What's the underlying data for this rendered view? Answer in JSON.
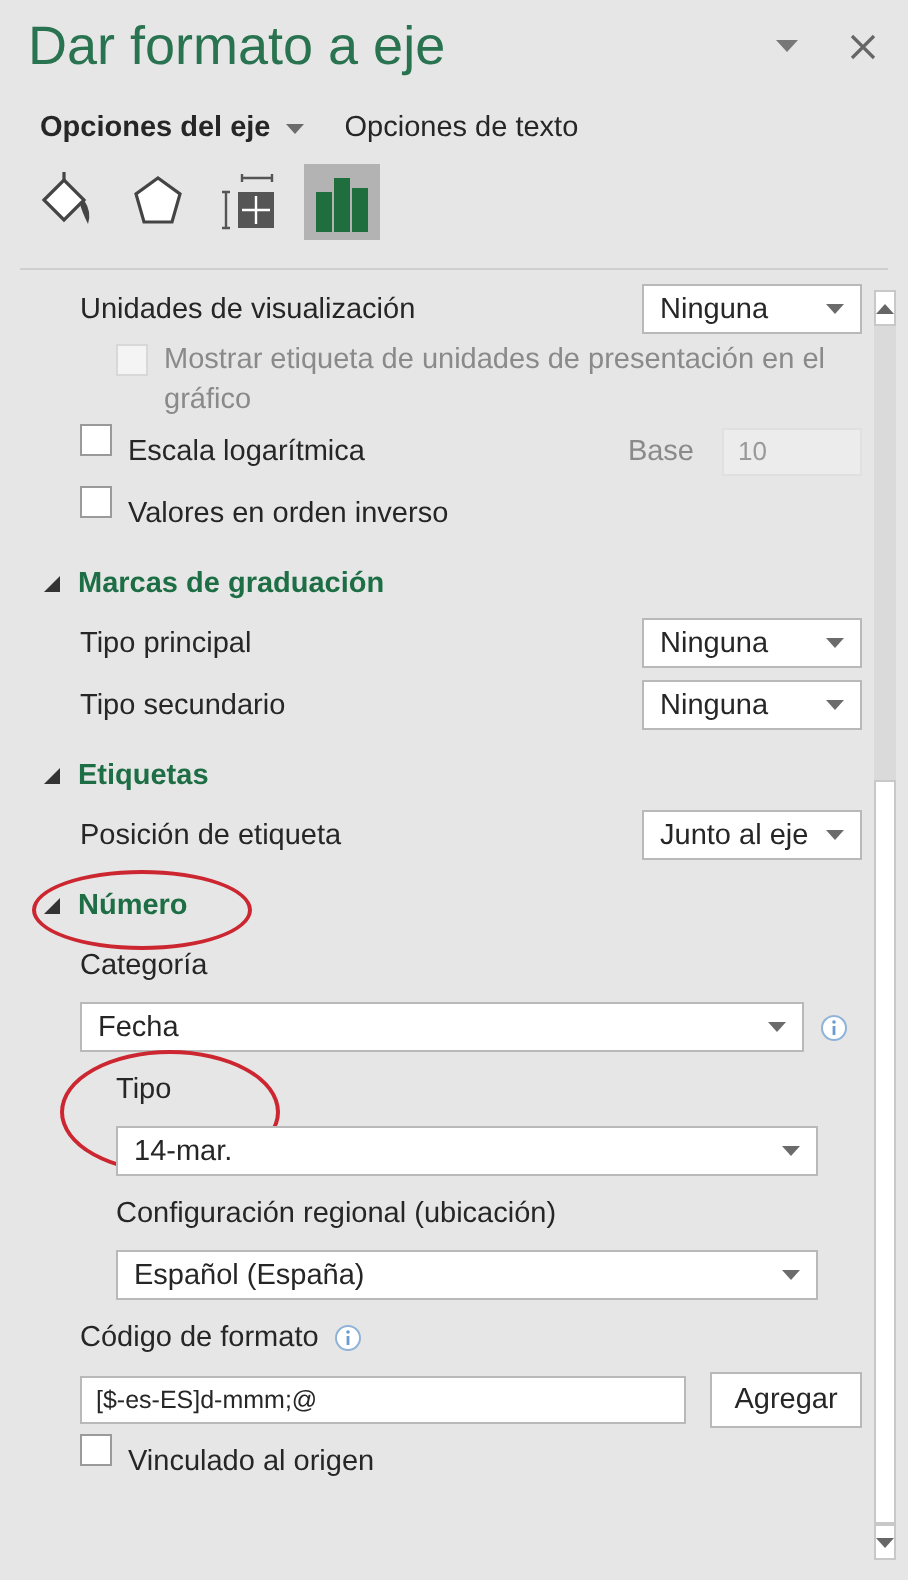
{
  "panel": {
    "title": "Dar formato a eje"
  },
  "tabs": [
    {
      "label": "Opciones del eje",
      "selected": true,
      "has_menu": true
    },
    {
      "label": "Opciones de texto",
      "selected": false,
      "has_menu": false
    }
  ],
  "icon_tabs": [
    {
      "kind": "fill",
      "selected": false
    },
    {
      "kind": "effects",
      "selected": false
    },
    {
      "kind": "size",
      "selected": false
    },
    {
      "kind": "axis",
      "selected": true
    }
  ],
  "top_items": [
    {
      "kind": "select",
      "label": "Unidades de visualización",
      "value": "Ninguna"
    },
    {
      "kind": "checkbox",
      "label": "Mostrar etiqueta de unidades de presentación en el gráfico",
      "checked": false,
      "disabled": true,
      "indent": true
    },
    {
      "kind": "checkbox_base",
      "label": "Escala logarítmica",
      "checked": false,
      "disabled": false,
      "base_label": "Base",
      "base_value": "10"
    },
    {
      "kind": "checkbox",
      "label": "Valores en orden inverso",
      "checked": false,
      "disabled": false,
      "indent": false
    }
  ],
  "sections": [
    {
      "title": "Marcas de graduación",
      "expanded": true,
      "circled": false,
      "items": [
        {
          "kind": "select",
          "label": "Tipo principal",
          "value": "Ninguna"
        },
        {
          "kind": "select",
          "label": "Tipo secundario",
          "value": "Ninguna"
        }
      ]
    },
    {
      "title": "Etiquetas",
      "expanded": true,
      "circled": false,
      "items": [
        {
          "kind": "select",
          "label": "Posición de etiqueta",
          "value": "Junto al eje"
        }
      ]
    },
    {
      "title": "Número",
      "expanded": true,
      "circled": true,
      "items": [
        {
          "kind": "label",
          "label": "Categoría",
          "indent": false,
          "circled": false
        },
        {
          "kind": "wide_select",
          "value": "Fecha",
          "indent": false,
          "info": true
        },
        {
          "kind": "label",
          "label": "Tipo",
          "indent": true,
          "circled": true
        },
        {
          "kind": "wide_select",
          "value": "14-mar.",
          "indent": true,
          "info": false
        },
        {
          "kind": "label",
          "label": "Configuración regional (ubicación)",
          "indent": true,
          "circled": false
        },
        {
          "kind": "wide_select",
          "value": "Español (España)",
          "indent": true,
          "info": false
        },
        {
          "kind": "label_info",
          "label": "Código de formato"
        },
        {
          "kind": "code_input",
          "value": "[$-es-ES]d-mmm;@",
          "button": "Agregar"
        },
        {
          "kind": "checkbox",
          "label": "Vinculado al origen",
          "checked": false,
          "disabled": false,
          "indent": false
        }
      ]
    }
  ]
}
